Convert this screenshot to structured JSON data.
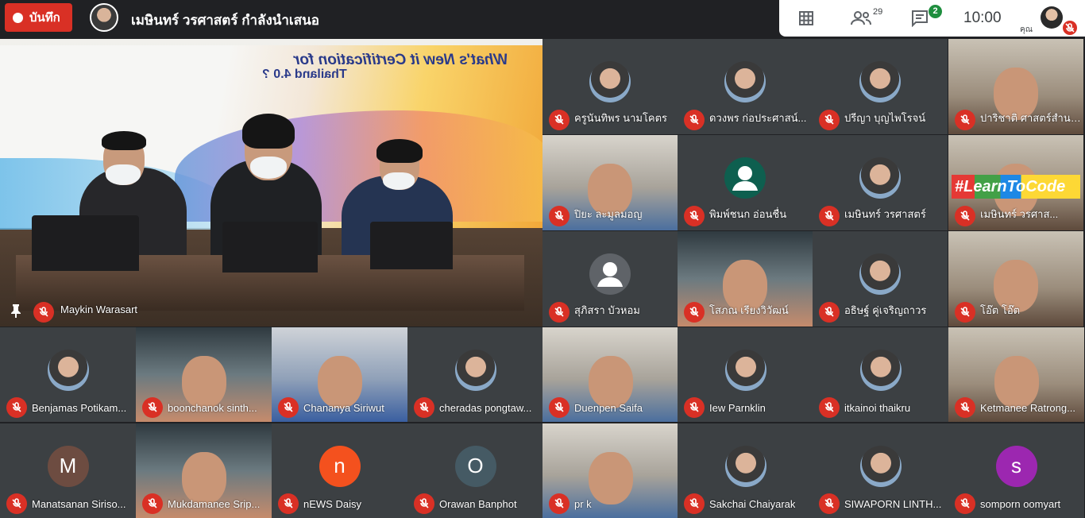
{
  "recording": {
    "label": "บันทึก",
    "color": "#d93025"
  },
  "presenter": {
    "title": "เมษินทร์ วรศาสตร์ กำลังนำเสนอ"
  },
  "toolbar": {
    "grid_icon": "grid-icon",
    "people_icon": "people-icon",
    "people_count": "29",
    "chat_icon": "chat-icon",
    "chat_badge": "2",
    "time": "10:00",
    "self_label": "คุณ"
  },
  "main_tile": {
    "name": "Maykin Warasart",
    "headline": "What's New it Certification for",
    "subheadline": "Thailand 4.0 ?"
  },
  "participants": [
    {
      "name": "ครูนันทิพร นามโคตร",
      "avatar": "photo",
      "color": "#3c4043"
    },
    {
      "name": "ดวงพร ก่อประศาสน์...",
      "avatar": "photo",
      "color": "#3c4043"
    },
    {
      "name": "ปรีญา บุญไพโรจน์",
      "avatar": "photo",
      "color": "#3c4043"
    },
    {
      "name": "ปาริชาติ ศาสตร์สำนวย",
      "avatar": "video",
      "color": "#3c4043"
    },
    {
      "name": "ปิยะ ละมูลมอญ",
      "avatar": "video",
      "color": "#3c4043"
    },
    {
      "name": "พิมพ์ชนก อ่อนชื่น",
      "avatar": "default",
      "color": "#0e5f4f"
    },
    {
      "name": "เมษินทร์ วรศาสตร์",
      "avatar": "photo",
      "color": "#3c4043"
    },
    {
      "name": "เมษินทร์ วรศาส...",
      "avatar": "video",
      "color": "#3c4043",
      "sign": "#LearnToCode Online"
    },
    {
      "name": "สุภิสรา บัวหอม",
      "avatar": "default",
      "color": "#5f6368"
    },
    {
      "name": "โสภณ เรียงวิวัฒน์",
      "avatar": "video",
      "color": "#3c4043"
    },
    {
      "name": "อธิษฐ์ คู่เจริญถาวร",
      "avatar": "photo",
      "color": "#3c4043"
    },
    {
      "name": "โอ๊ต โอ๊ต",
      "avatar": "video",
      "color": "#3c4043"
    },
    {
      "name": "Benjamas Potikam...",
      "avatar": "photo",
      "color": "#3c4043"
    },
    {
      "name": "boonchanok sinth...",
      "avatar": "video",
      "color": "#3c4043"
    },
    {
      "name": "Chananya Siriwut",
      "avatar": "video",
      "color": "#3c4043"
    },
    {
      "name": "cheradas pongtaw...",
      "avatar": "photo",
      "color": "#3c4043"
    },
    {
      "name": "Duenpen Saifa",
      "avatar": "video",
      "color": "#3c4043"
    },
    {
      "name": "Iew Parnklin",
      "avatar": "photo",
      "color": "#3c4043"
    },
    {
      "name": "itkainoi thaikru",
      "avatar": "photo",
      "color": "#3c4043"
    },
    {
      "name": "Ketmanee Ratrong...",
      "avatar": "video",
      "color": "#3c4043"
    },
    {
      "name": "Manatsanan Siriso...",
      "avatar": "letter",
      "letter": "M",
      "color": "#6d4c41"
    },
    {
      "name": "Mukdamanee Srip...",
      "avatar": "video",
      "color": "#3c4043"
    },
    {
      "name": "nEWS Daisy",
      "avatar": "letter",
      "letter": "n",
      "color": "#f4511e"
    },
    {
      "name": "Orawan Banphot",
      "avatar": "letter",
      "letter": "O",
      "color": "#455a64"
    },
    {
      "name": "pr k",
      "avatar": "video",
      "color": "#3c4043"
    },
    {
      "name": "Sakchai Chaiyarak",
      "avatar": "photo",
      "color": "#3c4043"
    },
    {
      "name": "SIWAPORN LINTH...",
      "avatar": "photo",
      "color": "#3c4043"
    },
    {
      "name": "somporn oomyart",
      "avatar": "letter",
      "letter": "s",
      "color": "#9c27b0"
    }
  ]
}
